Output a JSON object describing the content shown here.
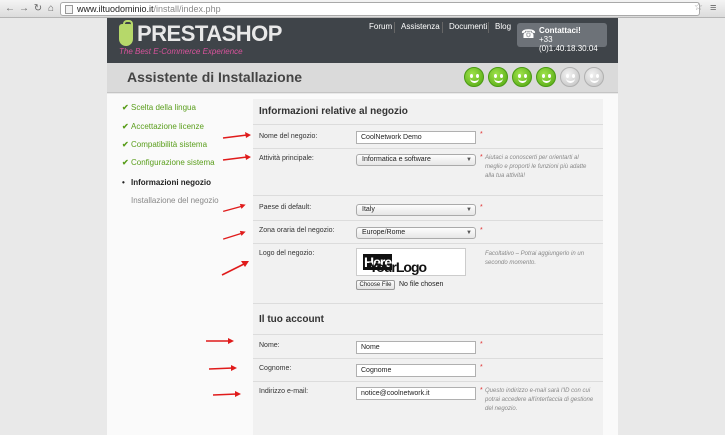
{
  "browser": {
    "url_domain": "www.iltuodominio.it",
    "url_path": "/install/index.php",
    "back_icon": "back-arrow-icon",
    "forward_icon": "forward-arrow-icon",
    "reload_icon": "reload-icon",
    "home_icon": "home-icon"
  },
  "header": {
    "logo_text": "PRESTASHOP",
    "logo_tagline": "The Best E-Commerce Experience",
    "nav": [
      "Forum",
      "Assistenza",
      "Documenti",
      "Blog"
    ],
    "contact_label": "Contattaci!",
    "contact_phone": "+33 (0)1.40.18.30.04"
  },
  "title": "Assistente di Installazione",
  "progress": {
    "completed_steps": 4,
    "total_steps": 6
  },
  "sidebar": [
    {
      "label": "Scelta della lingua",
      "status": "done"
    },
    {
      "label": "Accettazione licenze",
      "status": "done"
    },
    {
      "label": "Compatibilità sistema",
      "status": "done"
    },
    {
      "label": "Configurazione sistema",
      "status": "done"
    },
    {
      "label": "Informazioni negozio",
      "status": "current"
    },
    {
      "label": "Installazione del negozio",
      "status": "future"
    }
  ],
  "shop_section": {
    "title": "Informazioni relative al negozio",
    "shop_name_label": "Nome del negozio:",
    "shop_name_value": "CoolNetwork Demo",
    "activity_label": "Attività principale:",
    "activity_value": "Informatica e software",
    "activity_hint": "Aiutaci a conoscerti per orientarti al meglio e proporti le funzioni più adatte alla tua attività!",
    "country_label": "Paese di default:",
    "country_value": "Italy",
    "timezone_label": "Zona oraria del negozio:",
    "timezone_value": "Europe/Rome",
    "logo_label": "Logo del negozio:",
    "logo_hint": "Facoltativo – Potrai aggiungerlo in un secondo momento.",
    "logo_placeholder_a": "YourLogo",
    "logo_placeholder_b": "Here",
    "file_button": "Choose File",
    "file_status": "No file chosen"
  },
  "account_section": {
    "title": "Il tuo account",
    "first_name_label": "Nome:",
    "first_name_value": "Nome",
    "last_name_label": "Cognome:",
    "last_name_value": "Cognome",
    "email_label": "Indirizzo e-mail:",
    "email_value": "notice@coolnetwork.it",
    "email_hint": "Questo indirizzo e-mail sarà l'ID con cui potrai accedere all'interfaccia di gestione del negozio."
  },
  "required_marker": "*",
  "colors": {
    "header_bg": "#3f4449",
    "accent_green": "#5a9e1c",
    "logo_pink": "#d9539c",
    "arrow_red": "#e01b1b"
  }
}
